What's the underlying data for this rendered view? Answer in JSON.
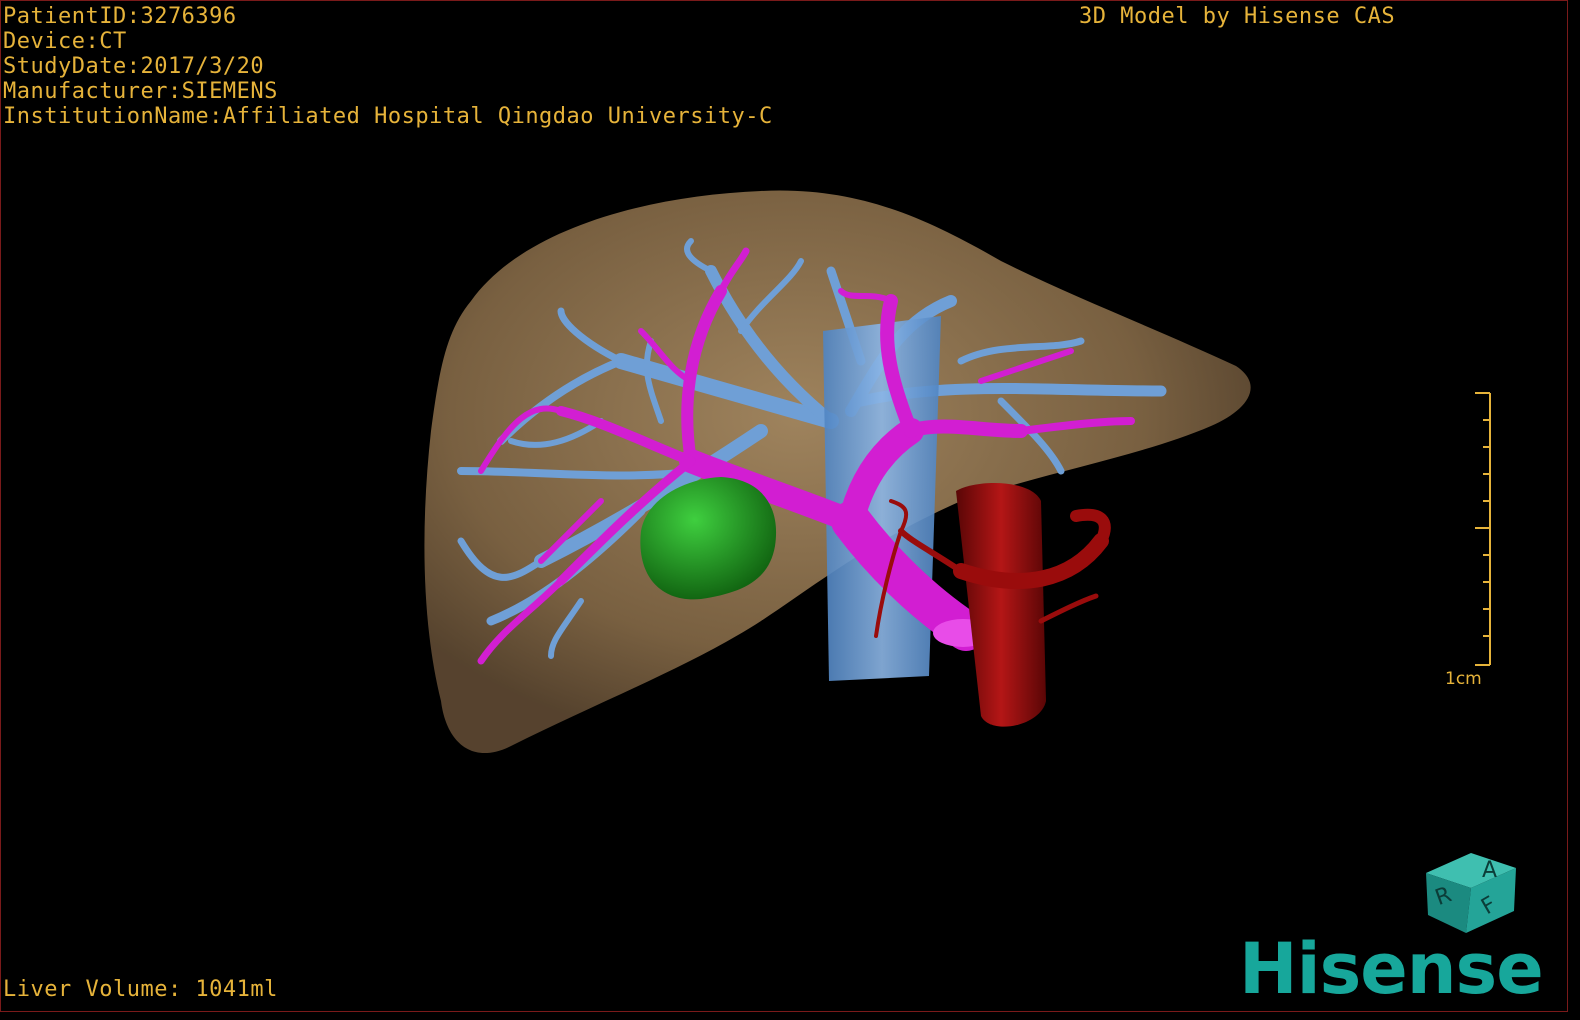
{
  "metadata": {
    "patient_id": "PatientID:3276396",
    "device": "Device:CT",
    "study_date": "StudyDate:2017/3/20",
    "manufacturer": "Manufacturer:SIEMENS",
    "institution": "InstitutionName:Affiliated Hospital Qingdao University-C"
  },
  "brand_title": "3D Model by Hisense CAS",
  "liver_volume": "Liver Volume: 1041ml",
  "scale_bar": {
    "label": "1cm"
  },
  "orientation_cube": {
    "face_top": "A",
    "face_left": "R",
    "face_right": "F"
  },
  "logo": {
    "text": "Hisense"
  },
  "colors": {
    "overlay_text": "#e6b33a",
    "liver": "#8a6e4c",
    "hepatic_vein": "#6f9fd6",
    "portal_vein": "#d21ed2",
    "tumor": "#2a9a2a",
    "artery": "#9a0c0c",
    "logo": "#17a79b"
  },
  "icons": {
    "orientation_cube": "orientation-cube-icon",
    "scale": "scale-bar-icon"
  }
}
